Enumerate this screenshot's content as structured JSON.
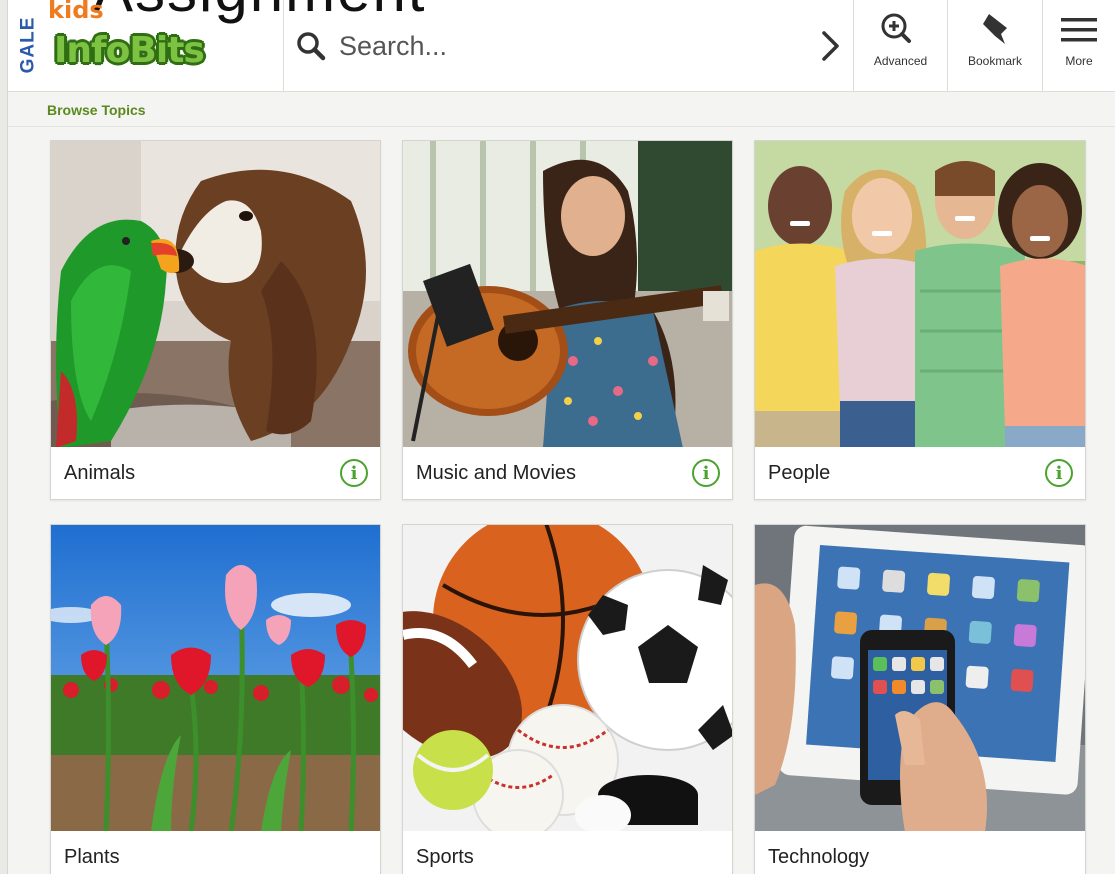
{
  "header": {
    "background_text": "Assignment",
    "logo": {
      "gale": "GALE",
      "kids": "kids",
      "brand": "InfoBits"
    },
    "search": {
      "placeholder": "Search..."
    },
    "tools": [
      {
        "label": "Advanced",
        "icon": "magnify-plus-icon"
      },
      {
        "label": "Bookmark",
        "icon": "bookmark-icon"
      },
      {
        "label": "More",
        "icon": "hamburger-menu-icon"
      }
    ]
  },
  "breadcrumb": {
    "label": "Browse Topics"
  },
  "topics": [
    {
      "label": "Animals",
      "info": true
    },
    {
      "label": "Music and Movies",
      "info": true
    },
    {
      "label": "People",
      "info": true
    },
    {
      "label": "Plants",
      "info": false
    },
    {
      "label": "Sports",
      "info": false
    },
    {
      "label": "Technology",
      "info": false
    }
  ],
  "colors": {
    "brand_green": "#7dc242",
    "brand_dark_green": "#2f6e12",
    "kids_orange": "#f07b1e",
    "gale_blue": "#2b5aa8",
    "info_green": "#4aa32e",
    "breadcrumb_green": "#5a8a1f"
  }
}
